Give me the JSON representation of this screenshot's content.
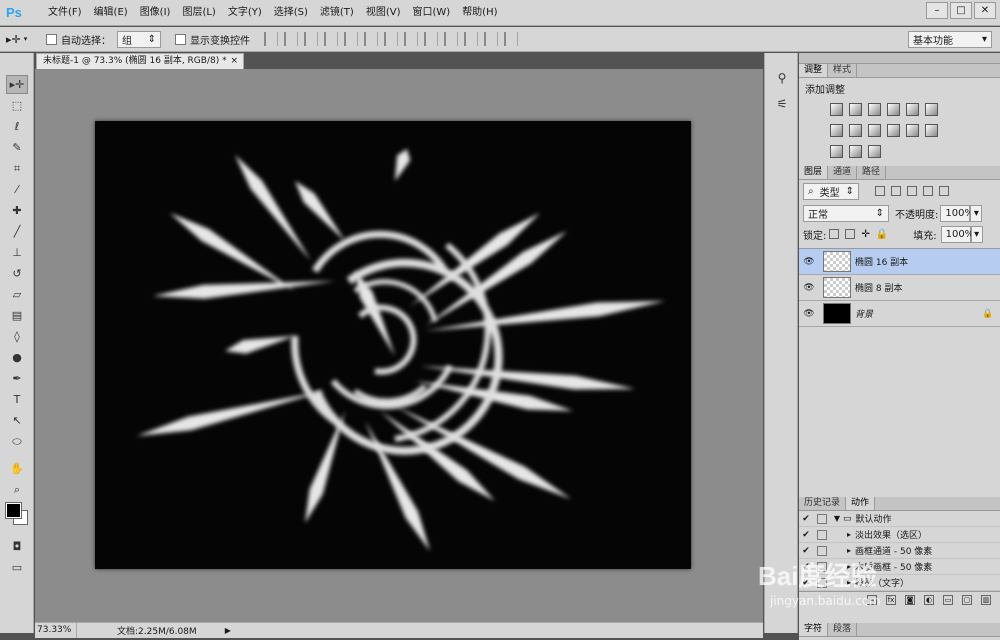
{
  "app": {
    "logo": "Ps"
  },
  "menu": [
    "文件(F)",
    "编辑(E)",
    "图像(I)",
    "图层(L)",
    "文字(Y)",
    "选择(S)",
    "滤镜(T)",
    "视图(V)",
    "窗口(W)",
    "帮助(H)"
  ],
  "options": {
    "auto_select_label": "自动选择：",
    "auto_select_value": "组",
    "transform_label": "显示变换控件",
    "workspace": "基本功能"
  },
  "document": {
    "tab_title": "未标题-1 @ 73.3% (椭圆 16 副本, RGB/8) *",
    "close": "×"
  },
  "status": {
    "zoom": "73.33%",
    "doc_info": "文档:2.25M/6.08M",
    "arrow": "▶"
  },
  "adjust_panel": {
    "tabs": [
      "调整",
      "样式"
    ],
    "title": "添加调整"
  },
  "layers_panel": {
    "tabs": [
      "图层",
      "通道",
      "路径"
    ],
    "filter_kind": "类型",
    "blend_mode": "正常",
    "opacity_label": "不透明度:",
    "opacity_value": "100%",
    "lock_label": "锁定:",
    "fill_label": "填充:",
    "fill_value": "100%",
    "layers": [
      {
        "name": "椭圆 16 副本",
        "thumb": "transparent"
      },
      {
        "name": "椭圆 8 副本",
        "thumb": "transparent"
      },
      {
        "name": "背景",
        "thumb": "black",
        "locked": true
      }
    ]
  },
  "actions_panel": {
    "tabs": [
      "历史记录",
      "动作"
    ],
    "rows": [
      "默认动作",
      "淡出效果（选区）",
      "画框通道 - 50 像素",
      "木质画框 - 50 像素",
      "投影（文字）"
    ]
  },
  "bottom_tabs": [
    "字符",
    "段落"
  ],
  "watermark": {
    "main": "Bai度经验",
    "sub": "jingyan.baidu.com"
  }
}
